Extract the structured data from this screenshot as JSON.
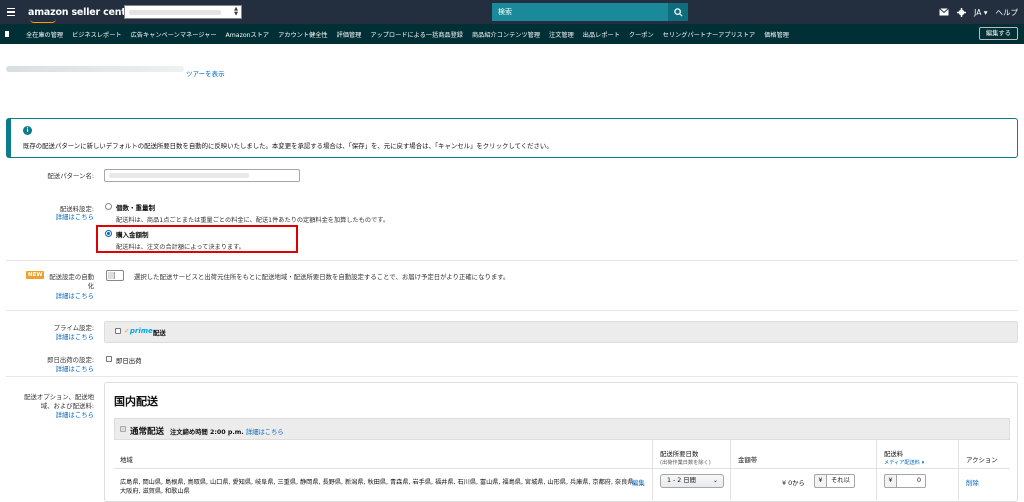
{
  "header": {
    "brand": "amazon seller central",
    "search_placeholder": "検索",
    "language": "JA",
    "help": "ヘルプ"
  },
  "nav": {
    "items": [
      "全在庫の管理",
      "ビジネスレポート",
      "広告キャンペーンマネージャー",
      "Amazonストア",
      "アカウント健全性",
      "評価管理",
      "アップロードによる一括商品登録",
      "商品紹介コンテンツ管理",
      "注文管理",
      "出品レポート",
      "クーポン",
      "セリングパートナーアプリストア",
      "価格管理"
    ],
    "edit_button": "編集する"
  },
  "tour_link": "ツアーを表示",
  "alert": {
    "message": "既存の配送パターンに新しいデフォルトの配送所要日数を自動的に反映いたしました。本変更を承認する場合は、「保存」を、元に戻す場合は、「キャンセル」をクリックしてください。"
  },
  "form": {
    "pattern_name_label": "配送パターン名:",
    "fee_label": "配送料設定:",
    "details_link": "詳細はこちら",
    "option_item": {
      "title": "個数・重量制",
      "desc": "配送料は、商品1点ごとまたは重量ごとの料金に、配送1件あたりの定額料金を加算したものです。"
    },
    "option_amount": {
      "title": "購入金額制",
      "desc": "配送料は、注文の合計額によって決まります。"
    },
    "auto_badge": "NEW",
    "auto_label_1": "配送設定の自動",
    "auto_label_2": "化",
    "auto_desc": "選択した配送サービスと出荷元住所をもとに配送地域・配送所要日数を自動設定することで、お届け予定日がより正確になります。",
    "prime_label": "プライム設定:",
    "prime_logo": "prime",
    "prime_text": "配送",
    "sameday_label": "即日出荷の設定:",
    "sameday_text": "即日出荷",
    "options_label_1": "配送オプション、配送地",
    "options_label_2": "域、および配送料:"
  },
  "domestic": {
    "title": "国内配送",
    "standard_title": "通常配送",
    "cutoff": "注文締め時間 2:00 p.m.",
    "cutoff_link": "詳細はこちら",
    "columns": {
      "region": "地域",
      "transit": "配送所要日数",
      "transit_sub": "(出荷作業日数を除く)",
      "amount_band": "金額帯",
      "fee": "配送料",
      "fee_sub": "メディア配送料",
      "action": "アクション"
    },
    "row": {
      "regions": "広島県, 岡山県, 島根県, 鳥取県, 山口県, 愛知県, 岐阜県, 三重県, 静岡県, 長野県, 新潟県, 秋田県, 青森県, 岩手県, 福井県, 石川県, 富山県, 福島県, 宮城県, 山形県, 兵庫県, 京都府, 奈良県, 大阪府, 滋賀県, 和歌山県",
      "edit": "編集",
      "transit_value": "1 - 2 日間",
      "from_amount": "¥ 0から",
      "currency": "¥",
      "upper": "それ以",
      "fee_value": "0",
      "delete": "削除"
    }
  },
  "colors": {
    "topbar": "#232f3e",
    "navbar": "#002f36",
    "search": "#1a8a9b",
    "accent": "#0b7c8a",
    "link": "#0066c0",
    "highlight": "#e00000"
  }
}
